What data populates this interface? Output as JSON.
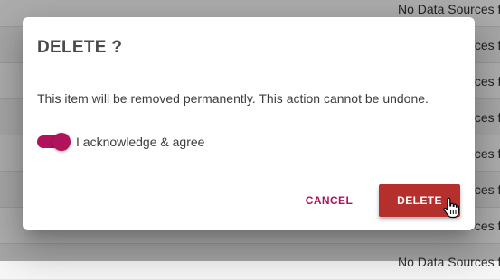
{
  "background": {
    "rows": [
      "No Data Sources f",
      "No Data Sources f",
      "No Data Sources f",
      "No Data Sources f",
      "No Data Sources f",
      "No Data Sources f",
      "No Data Sources f",
      "No Data Sources f"
    ]
  },
  "dialog": {
    "title": "DELETE ?",
    "message": "This item will be removed permanently. This action cannot be undone.",
    "acknowledge_label": "I acknowledge & agree",
    "acknowledge_checked": true,
    "cancel_label": "CANCEL",
    "delete_label": "DELETE"
  },
  "cursor": "hand-pointer-icon",
  "colors": {
    "accent": "#b0125b",
    "danger": "#b5302c"
  }
}
